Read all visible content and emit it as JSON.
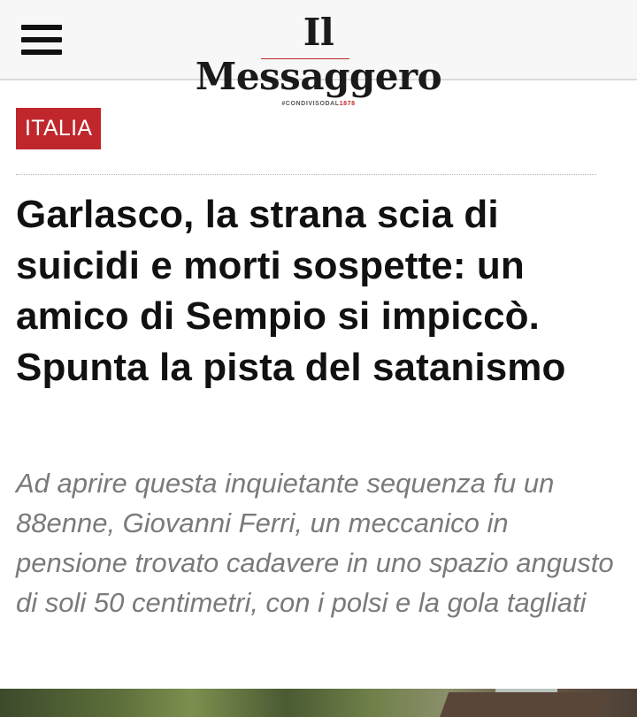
{
  "header": {
    "menu_icon": "hamburger-menu-icon",
    "logo_text": "Il Messaggero",
    "logo_tagline_prefix": "#CONDIVISODAL",
    "logo_tagline_year": "1878"
  },
  "article": {
    "section": "ITALIA",
    "headline": "Garlasco, la strana scia di suicidi e morti sospette: un amico di Sempio si impiccò. Spunta la pista del satanismo",
    "subtitle": "Ad aprire questa inquietante sequenza fu un 88enne, Giovanni Ferri, un meccanico in pensione trovato cadavere in uno spazio angusto di soli 50 centimetri, con i polsi e la gola tagliati"
  },
  "colors": {
    "accent": "#c0272d",
    "headline": "#111111",
    "subtitle": "#7a7a7a",
    "header_bg": "#f7f7f7"
  }
}
